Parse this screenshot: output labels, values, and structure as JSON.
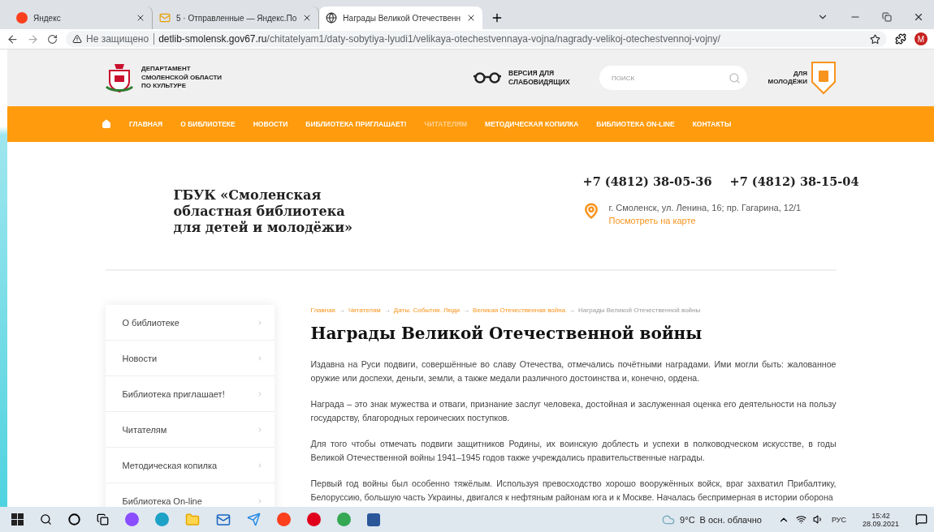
{
  "browser": {
    "tabs": [
      {
        "title": "Яндекс",
        "kind": "yandex",
        "selected": false
      },
      {
        "title": "5 · Отправленные — Яндекс.По",
        "kind": "mail",
        "selected": false
      },
      {
        "title": "Награды Великой Отечественн",
        "kind": "page",
        "selected": true
      }
    ],
    "address": {
      "security": "Не защищено",
      "host": "detlib-smolensk.gov67.ru",
      "path": "/chitatelyam1/daty-sobytiya-lyudi1/velikaya-otechestvennaya-vojna/nagrady-velikoj-otechestvennoj-vojny/"
    },
    "avatar": "M"
  },
  "header": {
    "organization": "ДЕПАРТАМЕНТ СМОЛЕНСКОЙ ОБЛАСТИ ПО КУЛЬТУРЕ",
    "accessibility": "ВЕРСИЯ ДЛЯ СЛАБОВИДЯЩИХ",
    "search": {
      "placeholder": "ПОИСК"
    },
    "youth": "ДЛЯ МОЛОДЁЖИ"
  },
  "nav": [
    {
      "label": "ГЛАВНАЯ",
      "selected": false
    },
    {
      "label": "О БИБЛИОТЕКЕ",
      "selected": false
    },
    {
      "label": "НОВОСТИ",
      "selected": false
    },
    {
      "label": "БИБЛИОТЕКА ПРИГЛАШАЕТ!",
      "selected": false
    },
    {
      "label": "ЧИТАТЕЛЯМ",
      "selected": true
    },
    {
      "label": "МЕТОДИЧЕСКАЯ КОПИЛКА",
      "selected": false
    },
    {
      "label": "БИБЛИОТЕКА ON-LINE",
      "selected": false
    },
    {
      "label": "КОНТАКТЫ",
      "selected": false
    }
  ],
  "library": {
    "name": "ГБУК «Смоленская областная библиотека для детей и молодёжи»",
    "phones": [
      "+7 (4812) 38-05-36",
      "+7 (4812) 38-15-04"
    ],
    "address": "г. Смоленск, ул. Ленина, 16; пр. Гагарина, 12/1",
    "map_link": "Посмотреть на карте"
  },
  "sidebar": {
    "items": [
      "О библиотеке",
      "Новости",
      "Библиотека приглашает!",
      "Читателям",
      "Методическая копилка",
      "Библиотека On-line"
    ]
  },
  "breadcrumbs": [
    {
      "label": "Главная",
      "current": false
    },
    {
      "label": "Читателям",
      "current": false
    },
    {
      "label": "Даты. События. Люди",
      "current": false
    },
    {
      "label": "Великая Отечественная война",
      "current": false
    },
    {
      "label": "Награды Великой Отечественной войны",
      "current": true
    }
  ],
  "breadcrumb_separator": "→",
  "article": {
    "title": "Награды Великой Отечественной войны",
    "paragraphs": [
      "Издавна на Руси подвиги, совершённые во славу Отечества, отмечались почётными наградами. Ими могли быть: жалованное оружие или доспехи, деньги, земли, а также медали различного достоинства и, конечно, ордена.",
      "Награда – это знак мужества и отваги, признание заслуг человека, достойная и заслуженная оценка его деятельности на пользу государству, благородных героических поступков.",
      "Для того чтобы отмечать подвиги защитников Родины, их воинскую доблесть и успехи в полководческом искусстве, в годы Великой Отечественной войны 1941–1945 годов также учреждались правительственные награды.",
      "Первый год войны был особенно тяжёлым. Используя превосходство хорошо вооружённых войск, враг захватил Прибалтику, Белоруссию, большую часть Украины, двигался к нефтяным районам юга и к Москве. Началась беспримерная в истории оборона"
    ]
  },
  "taskbar": {
    "weather": {
      "temperature": "9°C",
      "condition": "В осн. облачно"
    },
    "language": "РУС",
    "time": "15:42",
    "date": "28.09.2021"
  }
}
